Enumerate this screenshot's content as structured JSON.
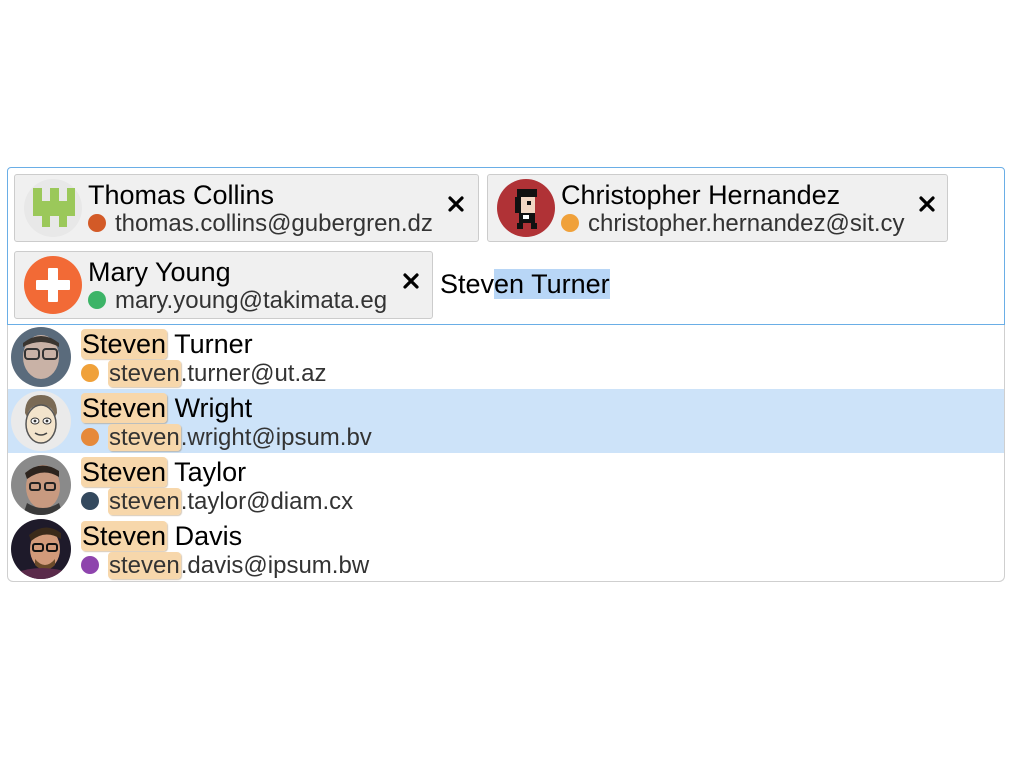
{
  "selected_recipients": [
    {
      "name": "Thomas Collins",
      "email": "thomas.collins@gubergren.dz",
      "status_color": "#d35a27",
      "avatar_icon": "green-pattern-avatar-icon"
    },
    {
      "name": "Christopher Hernandez",
      "email": "christopher.hernandez@sit.cy",
      "status_color": "#f0a13a",
      "avatar_icon": "pixel-character-avatar-icon"
    },
    {
      "name": "Mary Young",
      "email": "mary.young@takimata.eg",
      "status_color": "#3cb467",
      "avatar_icon": "orange-cross-avatar-icon"
    }
  ],
  "remove_icon": "close-icon",
  "search": {
    "typed_prefix": "Stev",
    "selected_completion": "en Turner"
  },
  "suggestions": {
    "match_text_name": "Steven",
    "match_text_email": "steven",
    "items": [
      {
        "name_rest": " Turner",
        "email_rest": ".turner@ut.az",
        "status_color": "#f0a13a",
        "avatar_icon": "person-photo-avatar-icon",
        "active": false
      },
      {
        "name_rest": " Wright",
        "email_rest": ".wright@ipsum.bv",
        "status_color": "#e6893a",
        "avatar_icon": "cartoon-face-avatar-icon",
        "active": true
      },
      {
        "name_rest": " Taylor",
        "email_rest": ".taylor@diam.cx",
        "status_color": "#34495e",
        "avatar_icon": "person-photo-avatar-icon",
        "active": false
      },
      {
        "name_rest": " Davis",
        "email_rest": ".davis@ipsum.bw",
        "status_color": "#8e44ad",
        "avatar_icon": "person-photo-avatar-icon",
        "active": false
      }
    ]
  }
}
